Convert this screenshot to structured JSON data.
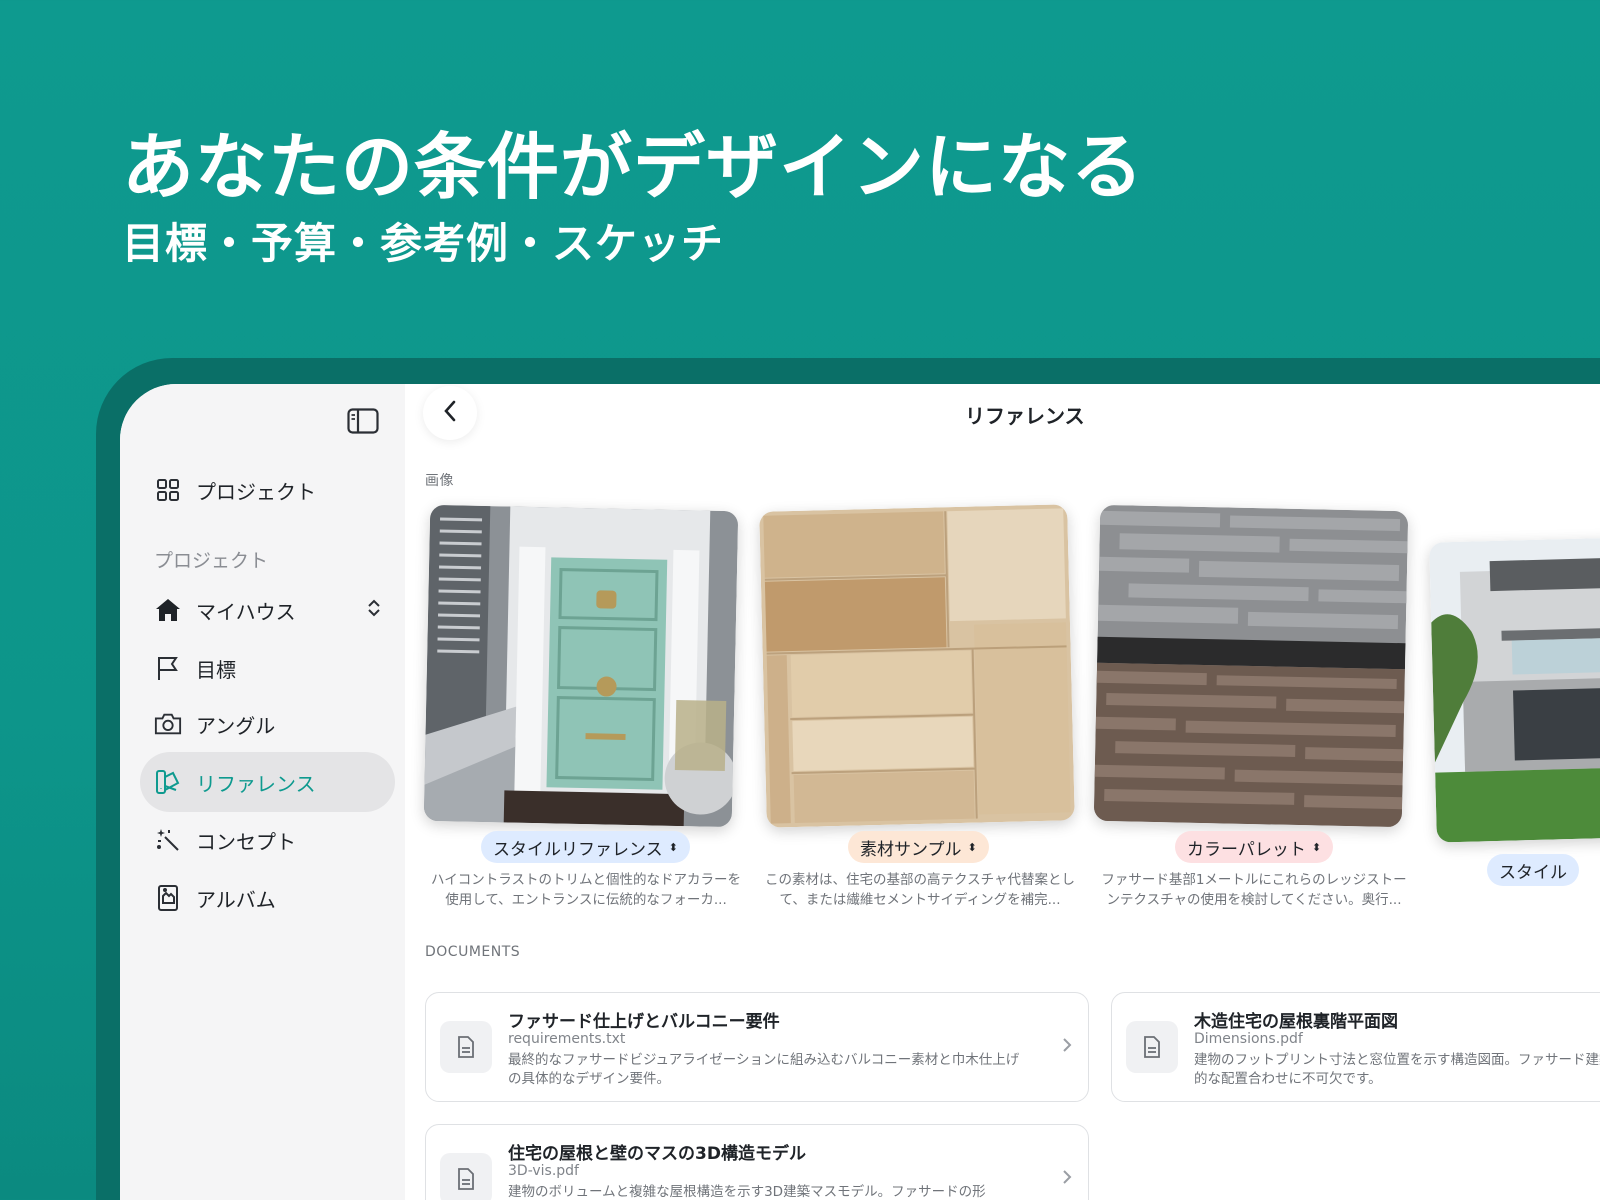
{
  "hero": {
    "title": "あなたの条件がデザインになる",
    "subtitle": "目標・予算・参考例・スケッチ"
  },
  "sidebar": {
    "top_item": "プロジェクト",
    "section_label": "プロジェクト",
    "items": [
      {
        "label": "マイハウス",
        "icon": "home-icon"
      },
      {
        "label": "目標",
        "icon": "flag-icon"
      },
      {
        "label": "アングル",
        "icon": "camera-icon"
      },
      {
        "label": "リファレンス",
        "icon": "swatch-icon"
      },
      {
        "label": "コンセプト",
        "icon": "sparkle-wand-icon"
      },
      {
        "label": "アルバム",
        "icon": "album-icon"
      }
    ]
  },
  "header": {
    "title": "リファレンス"
  },
  "images_section": {
    "label": "画像",
    "cards": [
      {
        "tag": "スタイルリファレンス",
        "desc": "ハイコントラストのトリムと個性的なドアカラーを使用して、エントランスに伝統的なフォーカ..."
      },
      {
        "tag": "素材サンプル",
        "desc": "この素材は、住宅の基部の高テクスチャ代替案として、または繊維セメントサイディングを補完..."
      },
      {
        "tag": "カラーパレット",
        "desc": "ファサード基部1メートルにこれらのレッジストーンテクスチャの使用を検討してください。奥行..."
      },
      {
        "tag": "スタイル",
        "desc": ""
      }
    ]
  },
  "documents_section": {
    "label": "DOCUMENTS",
    "docs": [
      {
        "title": "ファサード仕上げとバルコニー要件",
        "file": "requirements.txt",
        "desc": "最終的なファサードビジュアライゼーションに組み込むバルコニー素材と巾木仕上げの具体的なデザイン要件。"
      },
      {
        "title": "木造住宅の屋根裏階平面図",
        "file": "Dimensions.pdf",
        "desc": "建物のフットプリント寸法と窓位置を示す構造図面。ファサード建築的な配置合わせに不可欠です。"
      },
      {
        "title": "住宅の屋根と壁のマスの3D構造モデル",
        "file": "3D-vis.pdf",
        "desc": "建物のボリュームと複雑な屋根構造を示す3D建築マスモデル。ファサードの形"
      }
    ]
  },
  "colors": {
    "accent": "#0e9a8f",
    "background": "#0d958a"
  }
}
